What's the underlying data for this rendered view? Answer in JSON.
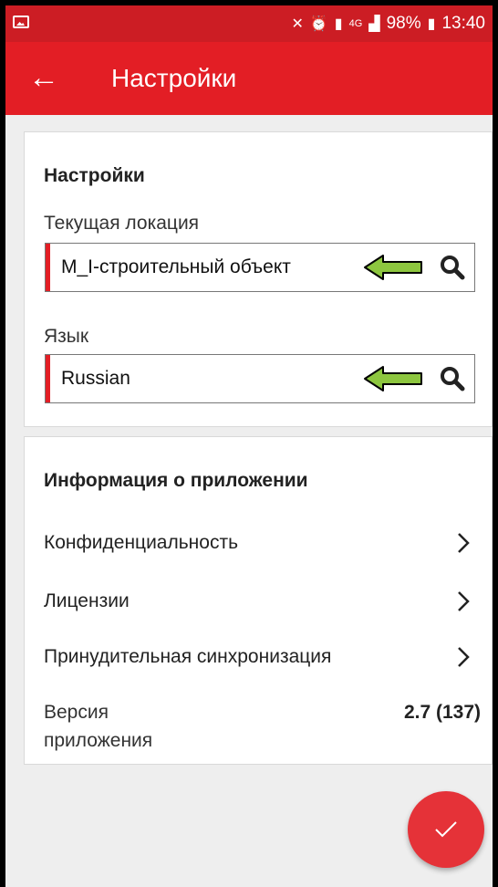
{
  "status_bar": {
    "battery": "98%",
    "time": "13:40",
    "network": "4G",
    "icons": [
      "image-icon",
      "mute-icon",
      "alarm-icon",
      "notification-icon",
      "signal-icon",
      "battery-icon"
    ]
  },
  "appbar": {
    "back_icon": "arrow-left-icon",
    "title": "Настройки"
  },
  "settings_card": {
    "title": "Настройки",
    "location_label": "Текущая локация",
    "location_value": "M_I-строительный объект",
    "language_label": "Язык",
    "language_value": "Russian"
  },
  "info_card": {
    "title": "Информация о приложении",
    "items": [
      {
        "label": "Конфиденциальность"
      },
      {
        "label": "Лицензии"
      },
      {
        "label": "Принудительная синхронизация"
      }
    ],
    "version_label": "Версия приложения",
    "version_value": "2.7 (137)"
  },
  "colors": {
    "accent": "#e31e25",
    "annotation_arrow": "#8dc63f"
  }
}
